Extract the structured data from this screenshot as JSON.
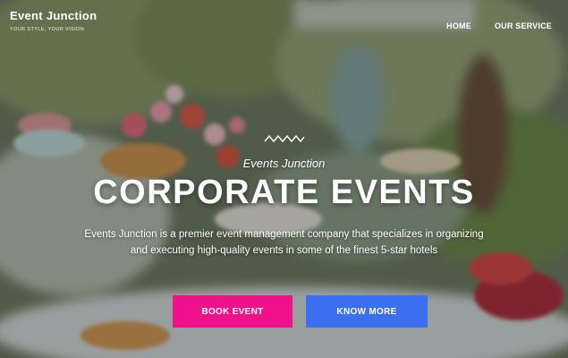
{
  "brand": {
    "name": "Event Junction",
    "tagline": "YOUR STYLE, YOUR VISION"
  },
  "nav": {
    "items": [
      "HOME",
      "OUR SERVICE"
    ]
  },
  "hero": {
    "kicker": "Events Junction",
    "headline": "CORPORATE EVENTS",
    "description": "Events Junction is a premier event management company that specializes in organizing and executing high-quality events in some of the finest 5-star hotels"
  },
  "buttons": {
    "book": "BOOK EVENT",
    "know": "KNOW MORE"
  },
  "colors": {
    "book": "#f0128a",
    "know": "#3b6ff0",
    "text": "#ffffff"
  },
  "icons": {
    "divider": "wave-divider-icon"
  }
}
